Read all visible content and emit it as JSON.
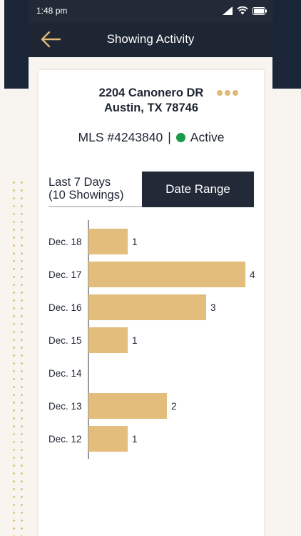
{
  "status_bar": {
    "time": "1:48 pm"
  },
  "nav": {
    "title": "Showing Activity"
  },
  "listing": {
    "address_line1": "2204 Canonero DR",
    "address_line2": "Austin, TX 78746",
    "mls": "MLS #4243840",
    "separator": "|",
    "status": "Active"
  },
  "tabs": {
    "last7_line1": "Last 7 Days",
    "last7_line2": "(10 Showings)",
    "date_range": "Date Range"
  },
  "colors": {
    "navy": "#1e2533",
    "gold": "#e0b978",
    "bar": "#e2bd7c",
    "active_status": "#1a9a4a"
  },
  "chart_data": {
    "type": "bar",
    "orientation": "horizontal",
    "categories": [
      "Dec. 18",
      "Dec. 17",
      "Dec. 16",
      "Dec. 15",
      "Dec. 14",
      "Dec. 13",
      "Dec. 12"
    ],
    "values": [
      1,
      4,
      3,
      1,
      0,
      2,
      1
    ],
    "value_labels": [
      "1",
      "4",
      "3",
      "1",
      "",
      "2",
      "1"
    ],
    "xlim": [
      0,
      4
    ],
    "grid": false,
    "legend": "none"
  }
}
